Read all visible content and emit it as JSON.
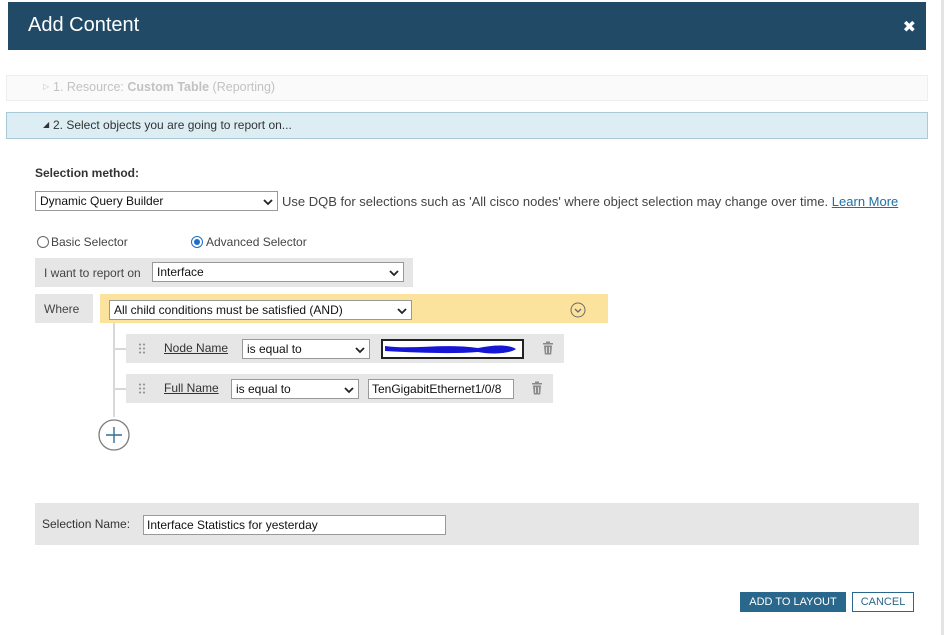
{
  "dialog": {
    "title": "Add Content",
    "close_symbol": "✖"
  },
  "steps": {
    "step1": {
      "prefix": "1. Resource: ",
      "resource": "Custom Table",
      "suffix": " (Reporting)"
    },
    "step2": {
      "label": "2. Select objects you are going to report on..."
    }
  },
  "selection": {
    "method_label": "Selection method:",
    "method_value": "Dynamic Query Builder",
    "method_description": "Use DQB for selections such as 'All cisco nodes' where object selection may change over time.",
    "learn_more": "Learn More",
    "selector_options": {
      "basic": {
        "label": "Basic Selector",
        "checked": false
      },
      "advanced": {
        "label": "Advanced Selector",
        "checked": true
      }
    },
    "report_on_label": "I want to report on",
    "report_on_value": "Interface",
    "where_label": "Where",
    "and_value": "All child conditions must be satisfied (AND)",
    "conditions": [
      {
        "field": "Node Name",
        "operator": "is equal to",
        "value": ""
      },
      {
        "field": "Full Name",
        "operator": "is equal to",
        "value": "TenGigabitEthernet1/0/8"
      }
    ],
    "name_label": "Selection Name:",
    "name_value": "Interface Statistics for yesterday"
  },
  "buttons": {
    "add_to_layout": "ADD TO LAYOUT",
    "cancel": "CANCEL"
  },
  "colors": {
    "titlebar": "#204a66",
    "primary": "#29688c",
    "and_row": "#fbe29d",
    "redaction": "#1616d6"
  }
}
